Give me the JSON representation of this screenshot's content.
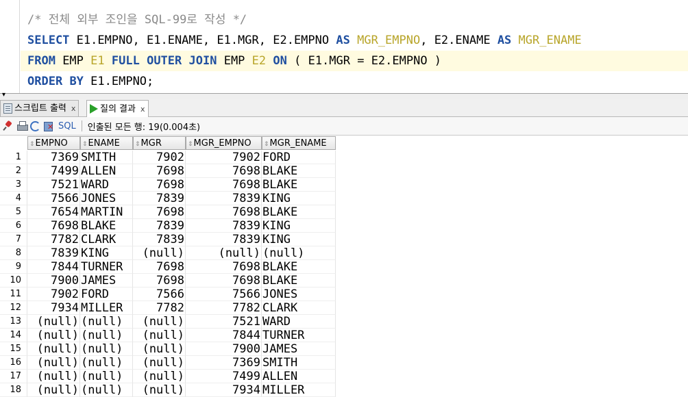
{
  "editor": {
    "comment": "/* 전체 외부 조인을 SQL-99로 작성 */",
    "line2": [
      {
        "t": "SELECT",
        "c": "kw"
      },
      {
        "t": " E1.EMPNO, E1.ENAME, E1.MGR, E2.EMPNO ",
        "c": ""
      },
      {
        "t": "AS",
        "c": "kw"
      },
      {
        "t": " ",
        "c": ""
      },
      {
        "t": "MGR_EMPNO",
        "c": "alias"
      },
      {
        "t": ", E2.ENAME ",
        "c": ""
      },
      {
        "t": "AS",
        "c": "kw"
      },
      {
        "t": " ",
        "c": ""
      },
      {
        "t": "MGR_ENAME",
        "c": "alias"
      }
    ],
    "line3": [
      {
        "t": "FROM",
        "c": "kw"
      },
      {
        "t": " EMP ",
        "c": ""
      },
      {
        "t": "E1",
        "c": "alias"
      },
      {
        "t": " ",
        "c": ""
      },
      {
        "t": "FULL",
        "c": "kw"
      },
      {
        "t": " ",
        "c": ""
      },
      {
        "t": "OUTER",
        "c": "kw"
      },
      {
        "t": " ",
        "c": ""
      },
      {
        "t": "JOIN",
        "c": "kw"
      },
      {
        "t": " EMP ",
        "c": ""
      },
      {
        "t": "E2",
        "c": "alias"
      },
      {
        "t": " ",
        "c": ""
      },
      {
        "t": "ON",
        "c": "kw"
      },
      {
        "t": " ( E1.MGR = E2.EMPNO )",
        "c": ""
      }
    ],
    "line4": [
      {
        "t": "ORDER",
        "c": "kw"
      },
      {
        "t": " ",
        "c": ""
      },
      {
        "t": "BY",
        "c": "kw"
      },
      {
        "t": " E1.EMPNO;",
        "c": ""
      }
    ]
  },
  "tabs": [
    {
      "label": "스크립트 출력",
      "close": "x",
      "icon": "script-output-icon"
    },
    {
      "label": "질의 결과",
      "close": "x",
      "icon": "run-query-icon"
    }
  ],
  "toolbar": {
    "sql_label": "SQL",
    "status": "인출된 모든 행: 19(0.004초)"
  },
  "grid": {
    "sort_glyph": "⇕",
    "columns": [
      "EMPNO",
      "ENAME",
      "MGR",
      "MGR_EMPNO",
      "MGR_ENAME"
    ],
    "rows": [
      [
        "1",
        "7369",
        "SMITH",
        "7902",
        "7902",
        "FORD"
      ],
      [
        "2",
        "7499",
        "ALLEN",
        "7698",
        "7698",
        "BLAKE"
      ],
      [
        "3",
        "7521",
        "WARD",
        "7698",
        "7698",
        "BLAKE"
      ],
      [
        "4",
        "7566",
        "JONES",
        "7839",
        "7839",
        "KING"
      ],
      [
        "5",
        "7654",
        "MARTIN",
        "7698",
        "7698",
        "BLAKE"
      ],
      [
        "6",
        "7698",
        "BLAKE",
        "7839",
        "7839",
        "KING"
      ],
      [
        "7",
        "7782",
        "CLARK",
        "7839",
        "7839",
        "KING"
      ],
      [
        "8",
        "7839",
        "KING",
        "(null)",
        "(null)",
        "(null)"
      ],
      [
        "9",
        "7844",
        "TURNER",
        "7698",
        "7698",
        "BLAKE"
      ],
      [
        "10",
        "7900",
        "JAMES",
        "7698",
        "7698",
        "BLAKE"
      ],
      [
        "11",
        "7902",
        "FORD",
        "7566",
        "7566",
        "JONES"
      ],
      [
        "12",
        "7934",
        "MILLER",
        "7782",
        "7782",
        "CLARK"
      ],
      [
        "13",
        "(null)",
        "(null)",
        "(null)",
        "7521",
        "WARD"
      ],
      [
        "14",
        "(null)",
        "(null)",
        "(null)",
        "7844",
        "TURNER"
      ],
      [
        "15",
        "(null)",
        "(null)",
        "(null)",
        "7900",
        "JAMES"
      ],
      [
        "16",
        "(null)",
        "(null)",
        "(null)",
        "7369",
        "SMITH"
      ],
      [
        "17",
        "(null)",
        "(null)",
        "(null)",
        "7499",
        "ALLEN"
      ],
      [
        "18",
        "(null)",
        "(null)",
        "(null)",
        "7934",
        "MILLER"
      ]
    ]
  }
}
